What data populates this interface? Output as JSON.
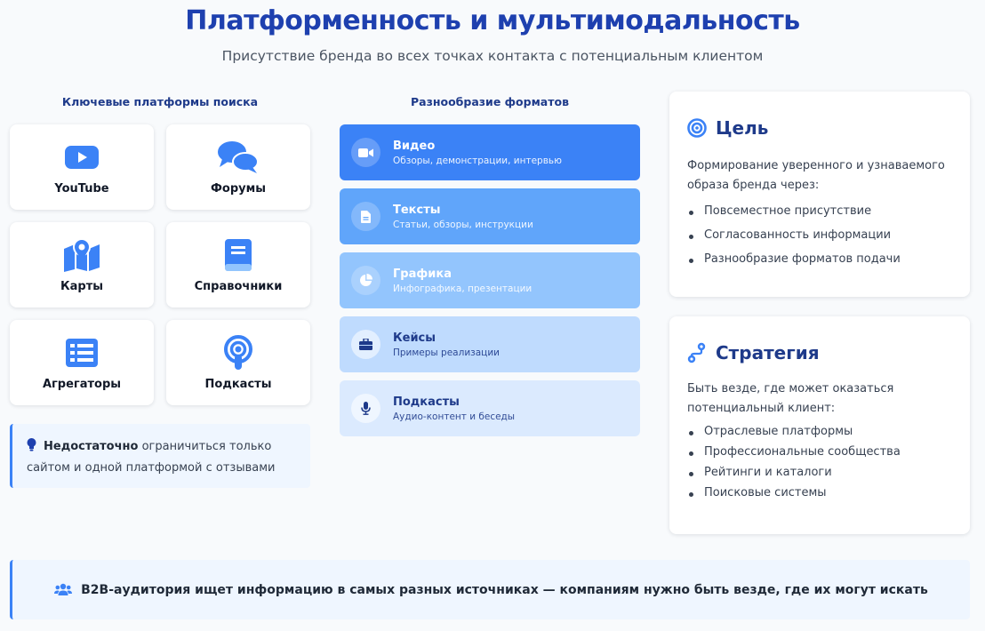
{
  "header": {
    "title": "Платформенность и мультимодальность",
    "subtitle": "Присутствие бренда во всех точках контакта с потенциальным клиентом"
  },
  "platforms": {
    "heading": "Ключевые платформы поиска",
    "items": [
      {
        "label": "YouTube",
        "icon": "youtube-icon"
      },
      {
        "label": "Форумы",
        "icon": "comments-icon"
      },
      {
        "label": "Карты",
        "icon": "map-pin-icon"
      },
      {
        "label": "Справочники",
        "icon": "book-icon"
      },
      {
        "label": "Агрегаторы",
        "icon": "list-icon"
      },
      {
        "label": "Подкасты",
        "icon": "podcast-icon"
      }
    ],
    "note_bold": "Недостаточно",
    "note_text": " ограничиться только сайтом и одной платформой с отзывами"
  },
  "formats": {
    "heading": "Разнообразие форматов",
    "items": [
      {
        "title": "Видео",
        "desc": "Обзоры, демонстрации, интервью",
        "icon": "video-icon",
        "bg": "#3b82f6",
        "text": "#ffffff"
      },
      {
        "title": "Тексты",
        "desc": "Статьи, обзоры, инструкции",
        "icon": "document-icon",
        "bg": "#60a5fa",
        "text": "#ffffff"
      },
      {
        "title": "Графика",
        "desc": "Инфографика, презентации",
        "icon": "pie-chart-icon",
        "bg": "#93c5fd",
        "text": "#ffffff"
      },
      {
        "title": "Кейсы",
        "desc": "Примеры реализации",
        "icon": "briefcase-icon",
        "bg": "#bfdbfe",
        "text": "#1e3a8a"
      },
      {
        "title": "Подкасты",
        "desc": "Аудио-контент и беседы",
        "icon": "microphone-icon",
        "bg": "#dbeafe",
        "text": "#1e3a8a"
      }
    ]
  },
  "goal": {
    "title": "Цель",
    "text": "Формирование уверенного и узнаваемого образа бренда через:",
    "items": [
      "Повсеместное присутствие",
      "Согласованность информации",
      "Разнообразие форматов подачи"
    ]
  },
  "strategy": {
    "title": "Стратегия",
    "text": "Быть везде, где может оказаться потенциальный клиент:",
    "items": [
      "Отраслевые платформы",
      "Профессиональные сообщества",
      "Рейтинги и каталоги",
      "Поисковые системы"
    ]
  },
  "footer": {
    "text": "B2B-аудитория ищет информацию в самых разных источниках — компаниям нужно быть везде, где их могут искать"
  },
  "colors": {
    "accent": "#3b82f6",
    "title": "#1e40af",
    "light_bg": "#eff6ff"
  }
}
